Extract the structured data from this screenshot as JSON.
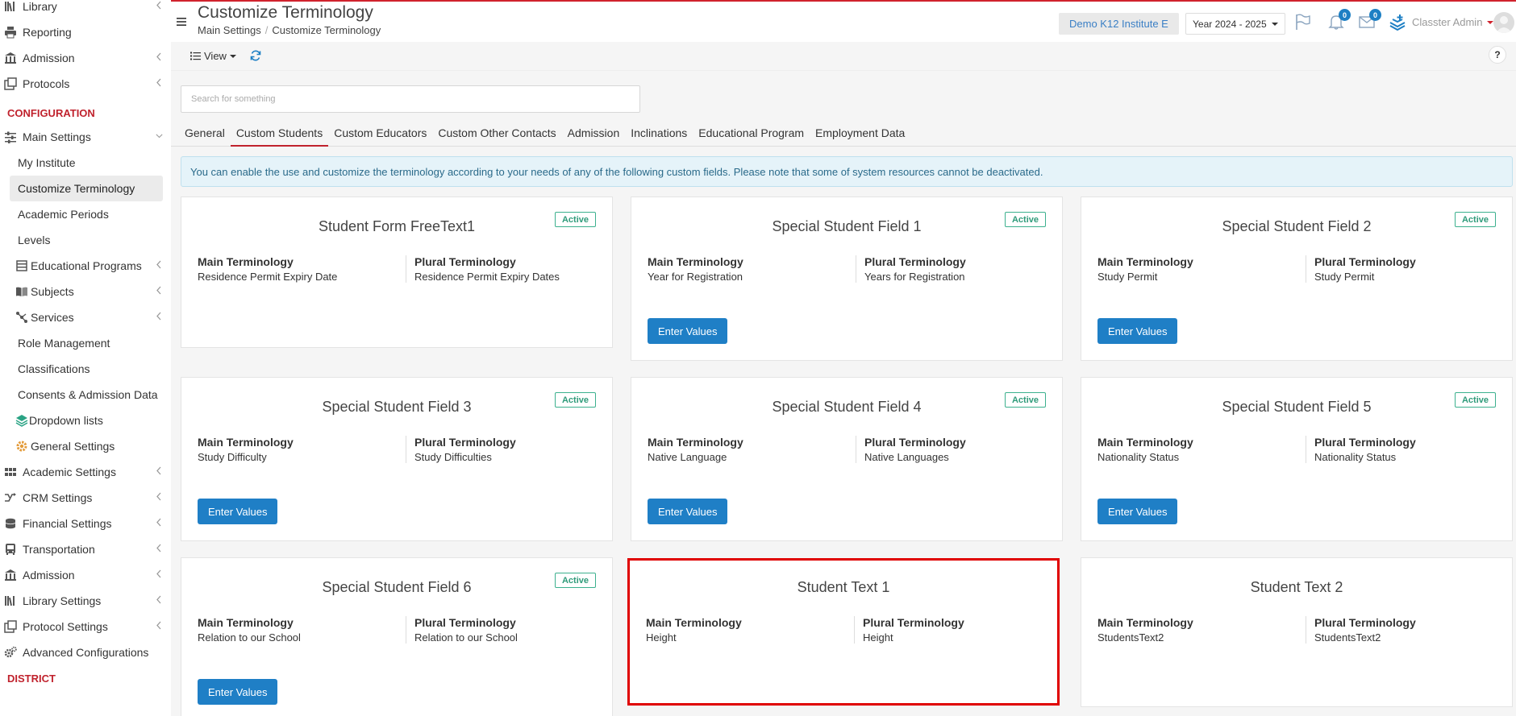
{
  "sidebar": {
    "top_items": [
      {
        "label": "Library",
        "icon": "library-icon",
        "has_chevron": true
      },
      {
        "label": "Reporting",
        "icon": "printer-icon",
        "has_chevron": false
      },
      {
        "label": "Admission",
        "icon": "institution-icon",
        "has_chevron": true
      },
      {
        "label": "Protocols",
        "icon": "protocols-icon",
        "has_chevron": true
      }
    ],
    "config_heading": "CONFIGURATION",
    "main_settings_label": "Main Settings",
    "main_settings_sub": [
      "My Institute",
      "Customize Terminology",
      "Academic Periods",
      "Levels"
    ],
    "educational_programs": "Educational Programs",
    "subjects": "Subjects",
    "services": "Services",
    "role_management": "Role Management",
    "classifications": "Classifications",
    "consents": "Consents & Admission Data",
    "dropdown_lists": "Dropdown lists",
    "general_settings": "General Settings",
    "bottom_items": [
      "Academic Settings",
      "CRM Settings",
      "Financial Settings",
      "Transportation",
      "Admission",
      "Library Settings",
      "Protocol Settings",
      "Advanced Configurations"
    ],
    "district_heading": "DISTRICT"
  },
  "header": {
    "title": "Customize Terminology",
    "breadcrumb": [
      "Main Settings",
      "Customize Terminology"
    ],
    "institute": "Demo K12 Institute E",
    "year": "Year 2024 - 2025",
    "notifications_count": "0",
    "messages_count": "0",
    "user": "Classter Admin"
  },
  "toolbar": {
    "view_label": "View",
    "help_label": "?"
  },
  "search": {
    "placeholder": "Search for something"
  },
  "tabs": [
    "General",
    "Custom Students",
    "Custom Educators",
    "Custom Other Contacts",
    "Admission",
    "Inclinations",
    "Educational Program",
    "Employment Data"
  ],
  "info_text": "You can enable the use and customize the terminology according to your needs of any of the following custom fields. Please note that some of system resources cannot be deactivated.",
  "labels": {
    "main_terminology": "Main Terminology",
    "plural_terminology": "Plural Terminology",
    "active": "Active",
    "enter_values": "Enter Values"
  },
  "cards": [
    {
      "title": "Student Form FreeText1",
      "main": "Residence Permit Expiry Date",
      "plural": "Residence Permit Expiry Dates"
    },
    {
      "title": "Special Student Field 1",
      "main": "Year for Registration",
      "plural": "Years for Registration"
    },
    {
      "title": "Special Student Field 2",
      "main": "Study Permit",
      "plural": "Study Permit"
    },
    {
      "title": "Special Student Field 3",
      "main": "Study Difficulty",
      "plural": "Study Difficulties"
    },
    {
      "title": "Special Student Field 4",
      "main": "Native Language",
      "plural": "Native Languages"
    },
    {
      "title": "Special Student Field 5",
      "main": "Nationality Status",
      "plural": "Nationality Status"
    },
    {
      "title": "Special Student Field 6",
      "main": "Relation to our School",
      "plural": "Relation to our School"
    },
    {
      "title": "Student Text 1",
      "main": "Height",
      "plural": "Height"
    },
    {
      "title": "Student Text 2",
      "main": "StudentsText2",
      "plural": "StudentsText2"
    }
  ],
  "colors": {
    "accent_red": "#c0222d",
    "primary_blue": "#1f7fc6",
    "active_green": "#2f9b7a"
  }
}
